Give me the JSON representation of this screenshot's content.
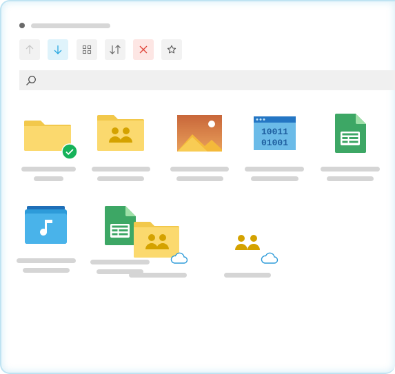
{
  "toolbar": {
    "buttons": [
      {
        "name": "up-arrow-icon",
        "state": "disabled"
      },
      {
        "name": "download-arrow-icon",
        "state": "active",
        "accent": "#29a8e0"
      },
      {
        "name": "grid-view-icon",
        "state": "normal"
      },
      {
        "name": "sort-icon",
        "state": "normal"
      },
      {
        "name": "close-icon",
        "state": "normal",
        "accent": "#e0463a"
      },
      {
        "name": "star-icon",
        "state": "normal"
      }
    ]
  },
  "search": {
    "icon": "search-icon",
    "placeholder": ""
  },
  "files": [
    {
      "icon": "folder-icon",
      "badge": "checkmark-icon",
      "color": "#fbd96e"
    },
    {
      "icon": "shared-folder-icon",
      "color": "#fbd96e"
    },
    {
      "icon": "image-icon"
    },
    {
      "icon": "binary-file-icon",
      "text_line1": "10011",
      "text_line2": "01001"
    },
    {
      "icon": "spreadsheet-icon",
      "color": "#3da765"
    },
    {
      "icon": "music-folder-icon",
      "color": "#2d9bd9"
    },
    {
      "icon": "spreadsheet-icon",
      "color": "#3da765"
    },
    {
      "icon": "shared-folder-icon",
      "badge": "cloud-icon"
    },
    {
      "icon": "people-icon",
      "badge": "cloud-icon"
    }
  ],
  "colors": {
    "border": "#bfe3f2",
    "placeholder_bar": "#d5d5d5",
    "folder": "#fbd96e",
    "people": "#d4a200"
  }
}
